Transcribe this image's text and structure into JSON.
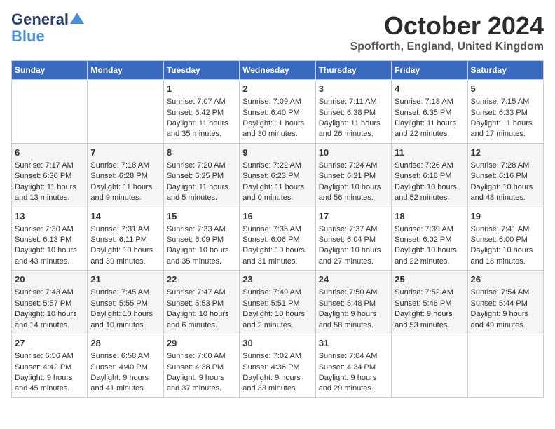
{
  "logo": {
    "line1": "General",
    "line2": "Blue"
  },
  "title": "October 2024",
  "location": "Spofforth, England, United Kingdom",
  "days_of_week": [
    "Sunday",
    "Monday",
    "Tuesday",
    "Wednesday",
    "Thursday",
    "Friday",
    "Saturday"
  ],
  "weeks": [
    [
      {
        "day": "",
        "sunrise": "",
        "sunset": "",
        "daylight": ""
      },
      {
        "day": "",
        "sunrise": "",
        "sunset": "",
        "daylight": ""
      },
      {
        "day": "1",
        "sunrise": "Sunrise: 7:07 AM",
        "sunset": "Sunset: 6:42 PM",
        "daylight": "Daylight: 11 hours and 35 minutes."
      },
      {
        "day": "2",
        "sunrise": "Sunrise: 7:09 AM",
        "sunset": "Sunset: 6:40 PM",
        "daylight": "Daylight: 11 hours and 30 minutes."
      },
      {
        "day": "3",
        "sunrise": "Sunrise: 7:11 AM",
        "sunset": "Sunset: 6:38 PM",
        "daylight": "Daylight: 11 hours and 26 minutes."
      },
      {
        "day": "4",
        "sunrise": "Sunrise: 7:13 AM",
        "sunset": "Sunset: 6:35 PM",
        "daylight": "Daylight: 11 hours and 22 minutes."
      },
      {
        "day": "5",
        "sunrise": "Sunrise: 7:15 AM",
        "sunset": "Sunset: 6:33 PM",
        "daylight": "Daylight: 11 hours and 17 minutes."
      }
    ],
    [
      {
        "day": "6",
        "sunrise": "Sunrise: 7:17 AM",
        "sunset": "Sunset: 6:30 PM",
        "daylight": "Daylight: 11 hours and 13 minutes."
      },
      {
        "day": "7",
        "sunrise": "Sunrise: 7:18 AM",
        "sunset": "Sunset: 6:28 PM",
        "daylight": "Daylight: 11 hours and 9 minutes."
      },
      {
        "day": "8",
        "sunrise": "Sunrise: 7:20 AM",
        "sunset": "Sunset: 6:25 PM",
        "daylight": "Daylight: 11 hours and 5 minutes."
      },
      {
        "day": "9",
        "sunrise": "Sunrise: 7:22 AM",
        "sunset": "Sunset: 6:23 PM",
        "daylight": "Daylight: 11 hours and 0 minutes."
      },
      {
        "day": "10",
        "sunrise": "Sunrise: 7:24 AM",
        "sunset": "Sunset: 6:21 PM",
        "daylight": "Daylight: 10 hours and 56 minutes."
      },
      {
        "day": "11",
        "sunrise": "Sunrise: 7:26 AM",
        "sunset": "Sunset: 6:18 PM",
        "daylight": "Daylight: 10 hours and 52 minutes."
      },
      {
        "day": "12",
        "sunrise": "Sunrise: 7:28 AM",
        "sunset": "Sunset: 6:16 PM",
        "daylight": "Daylight: 10 hours and 48 minutes."
      }
    ],
    [
      {
        "day": "13",
        "sunrise": "Sunrise: 7:30 AM",
        "sunset": "Sunset: 6:13 PM",
        "daylight": "Daylight: 10 hours and 43 minutes."
      },
      {
        "day": "14",
        "sunrise": "Sunrise: 7:31 AM",
        "sunset": "Sunset: 6:11 PM",
        "daylight": "Daylight: 10 hours and 39 minutes."
      },
      {
        "day": "15",
        "sunrise": "Sunrise: 7:33 AM",
        "sunset": "Sunset: 6:09 PM",
        "daylight": "Daylight: 10 hours and 35 minutes."
      },
      {
        "day": "16",
        "sunrise": "Sunrise: 7:35 AM",
        "sunset": "Sunset: 6:06 PM",
        "daylight": "Daylight: 10 hours and 31 minutes."
      },
      {
        "day": "17",
        "sunrise": "Sunrise: 7:37 AM",
        "sunset": "Sunset: 6:04 PM",
        "daylight": "Daylight: 10 hours and 27 minutes."
      },
      {
        "day": "18",
        "sunrise": "Sunrise: 7:39 AM",
        "sunset": "Sunset: 6:02 PM",
        "daylight": "Daylight: 10 hours and 22 minutes."
      },
      {
        "day": "19",
        "sunrise": "Sunrise: 7:41 AM",
        "sunset": "Sunset: 6:00 PM",
        "daylight": "Daylight: 10 hours and 18 minutes."
      }
    ],
    [
      {
        "day": "20",
        "sunrise": "Sunrise: 7:43 AM",
        "sunset": "Sunset: 5:57 PM",
        "daylight": "Daylight: 10 hours and 14 minutes."
      },
      {
        "day": "21",
        "sunrise": "Sunrise: 7:45 AM",
        "sunset": "Sunset: 5:55 PM",
        "daylight": "Daylight: 10 hours and 10 minutes."
      },
      {
        "day": "22",
        "sunrise": "Sunrise: 7:47 AM",
        "sunset": "Sunset: 5:53 PM",
        "daylight": "Daylight: 10 hours and 6 minutes."
      },
      {
        "day": "23",
        "sunrise": "Sunrise: 7:49 AM",
        "sunset": "Sunset: 5:51 PM",
        "daylight": "Daylight: 10 hours and 2 minutes."
      },
      {
        "day": "24",
        "sunrise": "Sunrise: 7:50 AM",
        "sunset": "Sunset: 5:48 PM",
        "daylight": "Daylight: 9 hours and 58 minutes."
      },
      {
        "day": "25",
        "sunrise": "Sunrise: 7:52 AM",
        "sunset": "Sunset: 5:46 PM",
        "daylight": "Daylight: 9 hours and 53 minutes."
      },
      {
        "day": "26",
        "sunrise": "Sunrise: 7:54 AM",
        "sunset": "Sunset: 5:44 PM",
        "daylight": "Daylight: 9 hours and 49 minutes."
      }
    ],
    [
      {
        "day": "27",
        "sunrise": "Sunrise: 6:56 AM",
        "sunset": "Sunset: 4:42 PM",
        "daylight": "Daylight: 9 hours and 45 minutes."
      },
      {
        "day": "28",
        "sunrise": "Sunrise: 6:58 AM",
        "sunset": "Sunset: 4:40 PM",
        "daylight": "Daylight: 9 hours and 41 minutes."
      },
      {
        "day": "29",
        "sunrise": "Sunrise: 7:00 AM",
        "sunset": "Sunset: 4:38 PM",
        "daylight": "Daylight: 9 hours and 37 minutes."
      },
      {
        "day": "30",
        "sunrise": "Sunrise: 7:02 AM",
        "sunset": "Sunset: 4:36 PM",
        "daylight": "Daylight: 9 hours and 33 minutes."
      },
      {
        "day": "31",
        "sunrise": "Sunrise: 7:04 AM",
        "sunset": "Sunset: 4:34 PM",
        "daylight": "Daylight: 9 hours and 29 minutes."
      },
      {
        "day": "",
        "sunrise": "",
        "sunset": "",
        "daylight": ""
      },
      {
        "day": "",
        "sunrise": "",
        "sunset": "",
        "daylight": ""
      }
    ]
  ]
}
